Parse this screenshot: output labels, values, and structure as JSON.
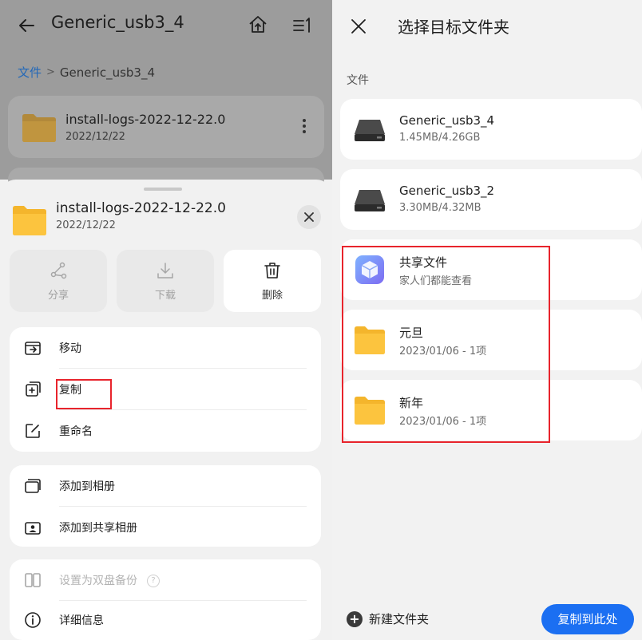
{
  "left": {
    "title": "Generic_usb3_4",
    "breadcrumb": {
      "root": "文件",
      "separator": ">",
      "current": "Generic_usb3_4"
    },
    "file": {
      "name": "install-logs-2022-12-22.0",
      "date": "2022/12/22"
    },
    "sheet": {
      "name": "install-logs-2022-12-22.0",
      "date": "2022/12/22",
      "actions": [
        {
          "label": "分享",
          "icon": "share-icon",
          "enabled": false
        },
        {
          "label": "下载",
          "icon": "download-icon",
          "enabled": false
        },
        {
          "label": "删除",
          "icon": "trash-icon",
          "enabled": true
        }
      ],
      "group1": [
        {
          "label": "移动",
          "icon": "move-icon"
        },
        {
          "label": "复制",
          "icon": "copy-icon"
        },
        {
          "label": "重命名",
          "icon": "rename-icon"
        }
      ],
      "group2": [
        {
          "label": "添加到相册",
          "icon": "album-icon"
        },
        {
          "label": "添加到共享相册",
          "icon": "shared-album-icon"
        }
      ],
      "group3": [
        {
          "label": "设置为双盘备份",
          "icon": "dual-disk-icon",
          "enabled": false
        },
        {
          "label": "详细信息",
          "icon": "info-icon",
          "enabled": true
        }
      ],
      "help_glyph": "?"
    }
  },
  "right": {
    "title": "选择目标文件夹",
    "section_label": "文件",
    "items": [
      {
        "name": "Generic_usb3_4",
        "sub": "1.45MB/4.26GB",
        "icon": "drive-icon"
      },
      {
        "name": "Generic_usb3_2",
        "sub": "3.30MB/4.32MB",
        "icon": "drive-icon"
      },
      {
        "name": "共享文件",
        "sub": "家人们都能查看",
        "icon": "shared-cube-icon"
      },
      {
        "name": "元旦",
        "sub": "2023/01/06 - 1项",
        "icon": "folder-icon"
      },
      {
        "name": "新年",
        "sub": "2023/01/06 - 1项",
        "icon": "folder-icon"
      }
    ],
    "new_folder_label": "新建文件夹",
    "copy_here_label": "复制到此处"
  },
  "colors": {
    "accent": "#1b6ff2",
    "highlight_red": "#e8242c",
    "folder_yellow": "#fcc43e",
    "breadcrumb_link": "#2368b8"
  }
}
